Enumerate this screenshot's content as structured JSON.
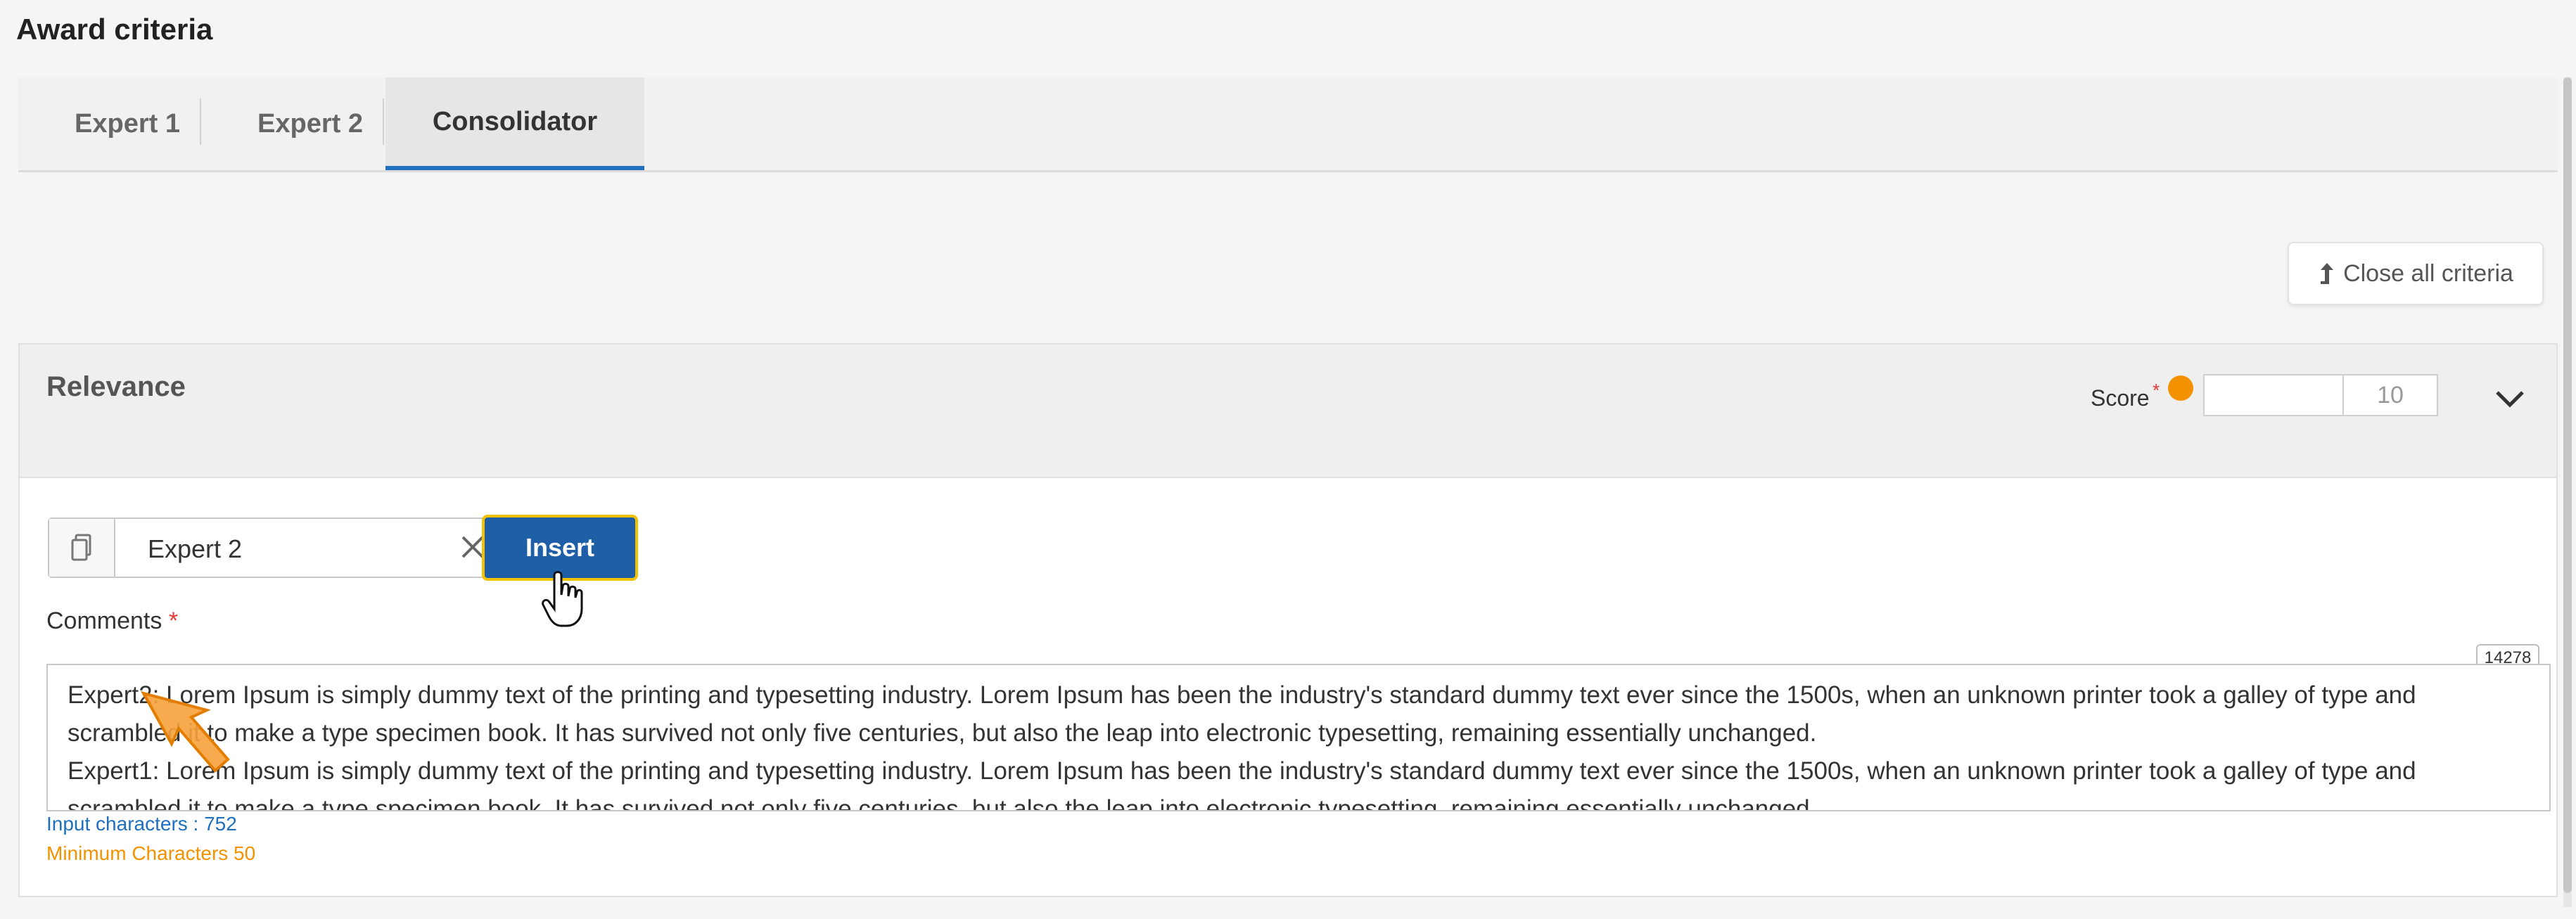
{
  "page": {
    "title": "Award criteria"
  },
  "tabs": [
    {
      "label": "Expert 1"
    },
    {
      "label": "Expert 2"
    },
    {
      "label": "Consolidator",
      "active": true
    }
  ],
  "toolbar": {
    "close_all_label": "Close all criteria",
    "close_all_icon": "arrow-up-icon"
  },
  "criterion": {
    "title": "Relevance",
    "score_label": "Score",
    "score_required_marker": "*",
    "score_value": "",
    "score_max": "10"
  },
  "template": {
    "selected": "Expert 2",
    "insert_label": "Insert"
  },
  "comments": {
    "label": "Comments",
    "required_marker": "*",
    "counter": "14278",
    "line1": "Expert2: Lorem Ipsum is simply dummy text of the printing and typesetting industry. Lorem Ipsum has been the industry's standard dummy text ever since the 1500s, when an unknown printer took a galley of type and scrambled it to make a type specimen book. It has survived not only five centuries, but also the leap into electronic typesetting, remaining essentially unchanged.",
    "line2": "Expert1: Lorem Ipsum is simply dummy text of the printing and typesetting industry. Lorem Ipsum has been the industry's standard dummy text ever since the 1500s, when an unknown printer took a galley of type and scrambled it to make a type specimen book. It has survived not only five centuries, but also the leap into electronic typesetting, remaining essentially unchanged.",
    "input_chars": "Input characters : 752",
    "min_chars": "Minimum Characters 50"
  },
  "colors": {
    "accent": "#1f5fa8",
    "tab_active": "#1f6fbf",
    "warning": "#f39200",
    "required": "#e53935"
  }
}
